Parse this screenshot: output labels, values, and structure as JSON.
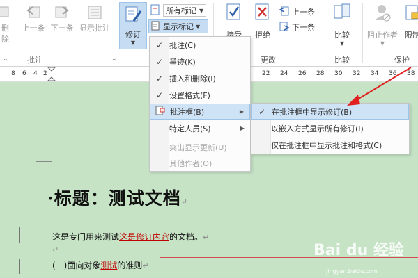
{
  "ribbon": {
    "comments_group": {
      "delete_label": "删除",
      "prev_label": "上一条",
      "next_label": "下一条",
      "show_label": "显示批注",
      "group_label": "批注"
    },
    "tracking_group": {
      "track_label": "修订",
      "markup_combo": "所有标记",
      "show_markup_label": "显示标记"
    },
    "changes_group": {
      "accept_label": "接受",
      "reject_label": "拒绝",
      "prev_label": "上一条",
      "next_label": "下一条",
      "group_label": "更改"
    },
    "compare_group": {
      "compare_label": "比较",
      "group_label": "比较"
    },
    "protect_group": {
      "block_authors_label": "阻止作者",
      "restrict_label": "限制",
      "group_label": "保护"
    }
  },
  "ruler": {
    "numbers": [
      "8",
      "6",
      "4",
      "2",
      "22",
      "24",
      "26",
      "28",
      "30",
      "32",
      "34",
      "36",
      "38",
      "40",
      "42",
      "44",
      "46",
      "48"
    ]
  },
  "show_markup_menu": {
    "items": [
      {
        "label": "批注(C)",
        "checked": true,
        "disabled": false
      },
      {
        "label": "墨迹(K)",
        "checked": true,
        "disabled": false
      },
      {
        "label": "插入和删除(I)",
        "checked": true,
        "disabled": false
      },
      {
        "label": "设置格式(F)",
        "checked": true,
        "disabled": false
      },
      {
        "label": "批注框(B)",
        "checked": false,
        "disabled": false,
        "submenu": true,
        "highlighted": true
      },
      {
        "label": "特定人员(S)",
        "checked": false,
        "disabled": false,
        "submenu": true
      },
      {
        "label": "突出显示更新(U)",
        "checked": false,
        "disabled": true
      },
      {
        "label": "其他作者(O)",
        "checked": false,
        "disabled": true
      }
    ]
  },
  "balloons_submenu": {
    "items": [
      {
        "label": "在批注框中显示修订(B)",
        "checked": true
      },
      {
        "label": "以嵌入方式显示所有修订(I)",
        "checked": false
      },
      {
        "label": "仅在批注框中显示批注和格式(C)",
        "checked": false
      }
    ]
  },
  "document": {
    "title": "·标题：测试文档",
    "para_mark": "↵",
    "line1_before": "这是专门用来测试",
    "line1_ins": "这是修订内容",
    "line1_after": "的文档。",
    "line3_before": "(一)面向对象",
    "line3_ins": "测试",
    "line3_after": "的准则"
  },
  "watermark": {
    "brand": "Bai du 经验",
    "url": "jingyan.baidu.com"
  },
  "colors": {
    "doc_background": "#c6e3c6",
    "highlight": "#cfe3f7",
    "revision_red": "#c00000",
    "arrow_red": "#e02020"
  }
}
